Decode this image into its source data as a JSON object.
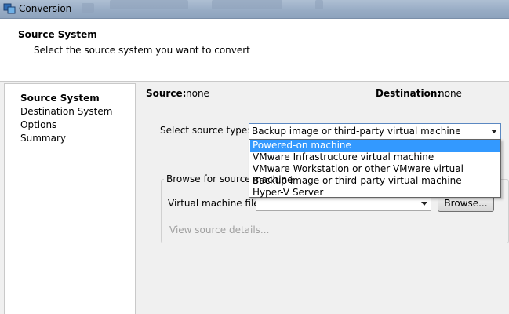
{
  "window": {
    "title": "Conversion"
  },
  "header": {
    "title": "Source System",
    "subtitle": "Select the source system you want to convert"
  },
  "nav": {
    "items": [
      {
        "label": "Source System",
        "active": true
      },
      {
        "label": "Destination System",
        "active": false
      },
      {
        "label": "Options",
        "active": false
      },
      {
        "label": "Summary",
        "active": false
      }
    ]
  },
  "summary": {
    "source_label": "Source:",
    "source_value": "none",
    "destination_label": "Destination:",
    "destination_value": "none"
  },
  "source_type": {
    "label": "Select source type:",
    "selected": "Backup image or third-party virtual machine",
    "options": [
      "Powered-on machine",
      "VMware Infrastructure virtual machine",
      "VMware Workstation or other VMware virtual machine",
      "Backup image or third-party virtual machine",
      "Hyper-V Server"
    ],
    "highlighted_index": 0
  },
  "browse": {
    "group_label": "Browse for source",
    "file_label": "Virtual machine file:",
    "file_value": "",
    "browse_button": "Browse...",
    "details_link": "View source details..."
  },
  "colors": {
    "selection": "#3399ff",
    "titlebar": "#aebfd3",
    "disabled_text": "#a0a0a0"
  }
}
